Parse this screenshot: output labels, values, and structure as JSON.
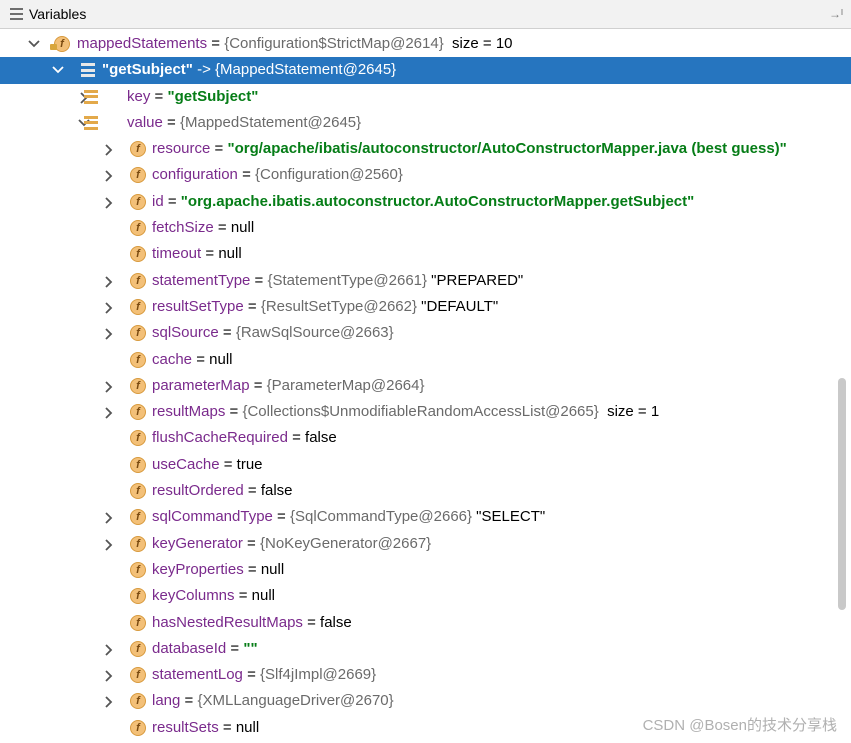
{
  "header": {
    "title": "Variables",
    "pin_glyph": "→ᴵ"
  },
  "rows": [
    {
      "indent": 0,
      "chevron": "down",
      "icon": "f",
      "name": "mappedStatements",
      "eq": " = ",
      "ref": "{Configuration$StrictMap@2614}",
      "extra": "  size = 10",
      "extra_class": "plain"
    },
    {
      "indent": 1,
      "chevron": "down",
      "icon": "arr",
      "selected": true,
      "name": "\"getSubject\"",
      "name_class": "str",
      "eq": " -> ",
      "ref": "{MappedStatement@2645}",
      "extra": "",
      "extra_class": "plain"
    },
    {
      "indent": 2,
      "chevron": "right",
      "icon": "arr",
      "name": "key",
      "eq": " = ",
      "ref": "",
      "extra": "\"getSubject\"",
      "extra_class": "str"
    },
    {
      "indent": 2,
      "chevron": "down",
      "icon": "arr",
      "name": "value",
      "eq": " = ",
      "ref": "{MappedStatement@2645}",
      "extra": "",
      "extra_class": "plain"
    },
    {
      "indent": 3,
      "chevron": "right",
      "icon": "f",
      "name": "resource",
      "eq": " = ",
      "ref": "",
      "extra": "\"org/apache/ibatis/autoconstructor/AutoConstructorMapper.java (best guess)\"",
      "extra_class": "str"
    },
    {
      "indent": 3,
      "chevron": "right",
      "icon": "f",
      "name": "configuration",
      "eq": " = ",
      "ref": "{Configuration@2560}",
      "extra": "",
      "extra_class": "plain"
    },
    {
      "indent": 3,
      "chevron": "right",
      "icon": "f",
      "name": "id",
      "eq": " = ",
      "ref": "",
      "extra": "\"org.apache.ibatis.autoconstructor.AutoConstructorMapper.getSubject\"",
      "extra_class": "str"
    },
    {
      "indent": 3,
      "chevron": "none",
      "icon": "f",
      "name": "fetchSize",
      "eq": " = ",
      "ref": "",
      "extra": "null",
      "extra_class": "plain"
    },
    {
      "indent": 3,
      "chevron": "none",
      "icon": "f",
      "name": "timeout",
      "eq": " = ",
      "ref": "",
      "extra": "null",
      "extra_class": "plain"
    },
    {
      "indent": 3,
      "chevron": "right",
      "icon": "f",
      "name": "statementType",
      "eq": " = ",
      "ref": "{StatementType@2661}",
      "extra": " \"PREPARED\"",
      "extra_class": "plain"
    },
    {
      "indent": 3,
      "chevron": "right",
      "icon": "f",
      "name": "resultSetType",
      "eq": " = ",
      "ref": "{ResultSetType@2662}",
      "extra": " \"DEFAULT\"",
      "extra_class": "plain"
    },
    {
      "indent": 3,
      "chevron": "right",
      "icon": "f",
      "name": "sqlSource",
      "eq": " = ",
      "ref": "{RawSqlSource@2663}",
      "extra": "",
      "extra_class": "plain"
    },
    {
      "indent": 3,
      "chevron": "none",
      "icon": "f",
      "name": "cache",
      "eq": " = ",
      "ref": "",
      "extra": "null",
      "extra_class": "plain"
    },
    {
      "indent": 3,
      "chevron": "right",
      "icon": "f",
      "name": "parameterMap",
      "eq": " = ",
      "ref": "{ParameterMap@2664}",
      "extra": "",
      "extra_class": "plain"
    },
    {
      "indent": 3,
      "chevron": "right",
      "icon": "f",
      "name": "resultMaps",
      "eq": " = ",
      "ref": "{Collections$UnmodifiableRandomAccessList@2665}",
      "extra": "  size = 1",
      "extra_class": "plain"
    },
    {
      "indent": 3,
      "chevron": "none",
      "icon": "f",
      "name": "flushCacheRequired",
      "eq": " = ",
      "ref": "",
      "extra": "false",
      "extra_class": "plain"
    },
    {
      "indent": 3,
      "chevron": "none",
      "icon": "f",
      "name": "useCache",
      "eq": " = ",
      "ref": "",
      "extra": "true",
      "extra_class": "plain"
    },
    {
      "indent": 3,
      "chevron": "none",
      "icon": "f",
      "name": "resultOrdered",
      "eq": " = ",
      "ref": "",
      "extra": "false",
      "extra_class": "plain"
    },
    {
      "indent": 3,
      "chevron": "right",
      "icon": "f",
      "name": "sqlCommandType",
      "eq": " = ",
      "ref": "{SqlCommandType@2666}",
      "extra": " \"SELECT\"",
      "extra_class": "plain"
    },
    {
      "indent": 3,
      "chevron": "right",
      "icon": "f",
      "name": "keyGenerator",
      "eq": " = ",
      "ref": "{NoKeyGenerator@2667}",
      "extra": "",
      "extra_class": "plain"
    },
    {
      "indent": 3,
      "chevron": "none",
      "icon": "f",
      "name": "keyProperties",
      "eq": " = ",
      "ref": "",
      "extra": "null",
      "extra_class": "plain"
    },
    {
      "indent": 3,
      "chevron": "none",
      "icon": "f",
      "name": "keyColumns",
      "eq": " = ",
      "ref": "",
      "extra": "null",
      "extra_class": "plain"
    },
    {
      "indent": 3,
      "chevron": "none",
      "icon": "f",
      "name": "hasNestedResultMaps",
      "eq": " = ",
      "ref": "",
      "extra": "false",
      "extra_class": "plain"
    },
    {
      "indent": 3,
      "chevron": "right",
      "icon": "f",
      "name": "databaseId",
      "eq": " = ",
      "ref": "",
      "extra": "\"\"",
      "extra_class": "str"
    },
    {
      "indent": 3,
      "chevron": "right",
      "icon": "f",
      "name": "statementLog",
      "eq": " = ",
      "ref": "{Slf4jImpl@2669}",
      "extra": "",
      "extra_class": "plain"
    },
    {
      "indent": 3,
      "chevron": "right",
      "icon": "f",
      "name": "lang",
      "eq": " = ",
      "ref": "{XMLLanguageDriver@2670}",
      "extra": "",
      "extra_class": "plain"
    },
    {
      "indent": 3,
      "chevron": "none",
      "icon": "f",
      "name": "resultSets",
      "eq": " = ",
      "ref": "",
      "extra": "null",
      "extra_class": "plain"
    }
  ],
  "watermark": "CSDN @Bosen的技术分享栈",
  "colors": {
    "selection": "#2675bf",
    "field_name": "#7a2a8c",
    "string": "#067d17",
    "ref": "#6a6a6a",
    "icon_field": "#f3c078"
  }
}
